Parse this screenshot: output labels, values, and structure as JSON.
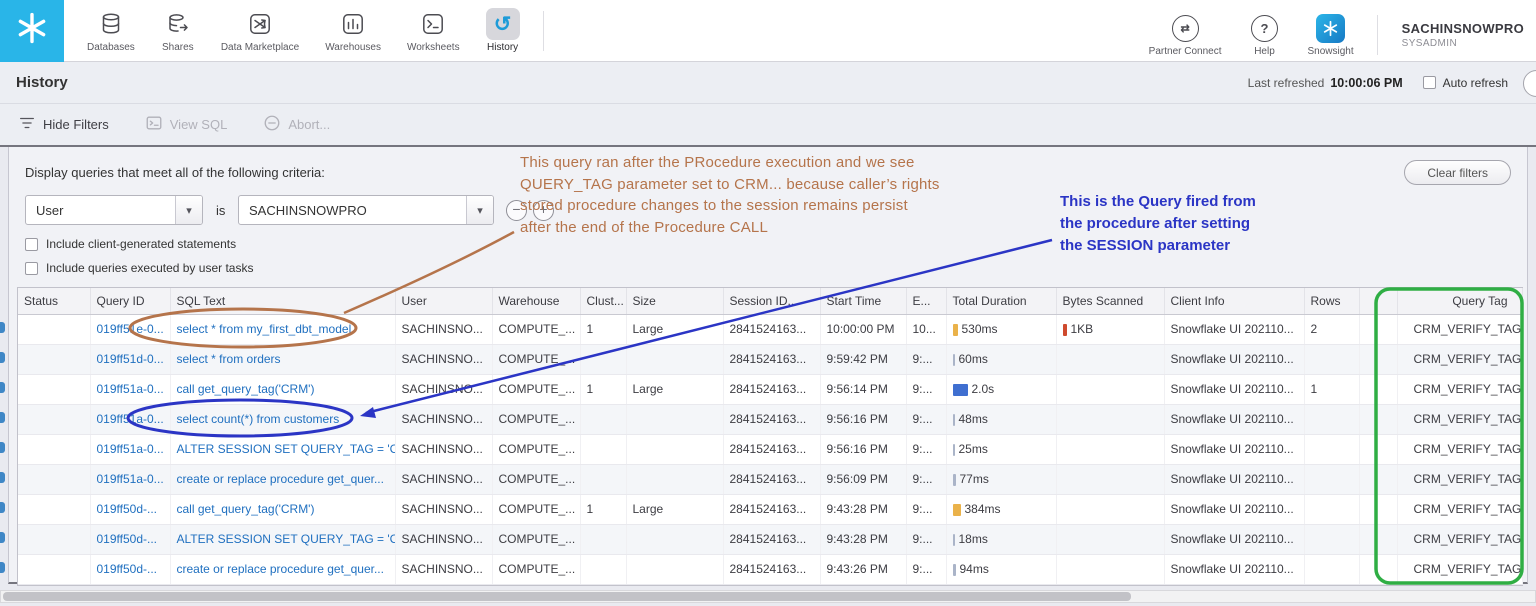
{
  "nav": {
    "account": "SACHINSNOWPRO",
    "role": "SYSADMIN",
    "items": [
      {
        "label": "Databases"
      },
      {
        "label": "Shares"
      },
      {
        "label": "Data Marketplace"
      },
      {
        "label": "Warehouses"
      },
      {
        "label": "Worksheets"
      },
      {
        "label": "History"
      }
    ],
    "right_items": [
      {
        "label": "Partner Connect"
      },
      {
        "label": "Help"
      },
      {
        "label": "Snowsight"
      }
    ]
  },
  "icons": {
    "logo": "snowflake-icon",
    "nav": [
      "databases-icon",
      "shares-icon",
      "marketplace-icon",
      "warehouses-icon",
      "worksheets-icon",
      "history-icon"
    ],
    "nav_right": [
      "partner-connect-icon",
      "help-icon",
      "snowsight-icon"
    ],
    "toolbar": [
      "filter-list-icon",
      "view-sql-icon",
      "abort-circle-icon"
    ],
    "misc": [
      "chevron-down-icon",
      "minus-icon",
      "plus-icon",
      "refresh-icon"
    ]
  },
  "header": {
    "title": "History",
    "last_refreshed_label": "Last refreshed",
    "last_refreshed_time": "10:00:06 PM",
    "auto_refresh_label": "Auto refresh"
  },
  "toolbar": {
    "hide_filters": "Hide Filters",
    "view_sql": "View SQL",
    "abort": "Abort..."
  },
  "filters": {
    "criteria_label": "Display queries that meet all of the following criteria:",
    "clear_button": "Clear filters",
    "field_selected": "User",
    "operator": "is",
    "value_selected": "SACHINSNOWPRO",
    "include_client_label": "Include client-generated statements",
    "include_tasks_label": "Include queries executed by user tasks"
  },
  "annotations": {
    "brown_note": "This query ran after the PRocedure execution and we see\nQUERY_TAG parameter set to CRM... because caller’s rights\nstored procedure changes to the session remains persist\nafter the end of the Procedure CALL",
    "blue_note": "This is the Query fired from\nthe procedure after setting\nthe SESSION parameter",
    "colors": {
      "brown": "#b5744b",
      "blue": "#2b35c5",
      "green": "#2fae44"
    }
  },
  "table": {
    "columns": [
      "Status",
      "Query ID",
      "SQL Text",
      "User",
      "Warehouse",
      "Clust...",
      "Size",
      "Session ID...",
      "Start Time",
      "E...",
      "Total Duration",
      "Bytes Scanned",
      "Client Info",
      "Rows",
      "",
      "Query Tag"
    ],
    "rows": [
      {
        "query_id": "019ff51e-0...",
        "sql": "select * from my_first_dbt_model",
        "user": "SACHINSNO...",
        "warehouse": "COMPUTE_...",
        "cluster": "1",
        "size": "Large",
        "session_id": "2841524163...",
        "start_time": "10:00:00 PM",
        "end_time": "10...",
        "duration": "530ms",
        "duration_bar": {
          "w": 5,
          "color": "#eab24a"
        },
        "bytes_scanned": "1KB",
        "bytes_bar": {
          "w": 4,
          "color": "#cf4a2e"
        },
        "client_info": "Snowflake UI 202110...",
        "rows": "2",
        "query_tag": "CRM_VERIFY_TAG"
      },
      {
        "query_id": "019ff51d-0...",
        "sql": "select * from orders",
        "user": "SACHINSNO...",
        "warehouse": "COMPUTE_...",
        "cluster": "",
        "size": "",
        "session_id": "2841524163...",
        "start_time": "9:59:42 PM",
        "end_time": "9:...",
        "duration": "60ms",
        "duration_bar": {
          "w": 2,
          "color": "#aab4c8"
        },
        "bytes_scanned": "",
        "bytes_bar": {
          "w": 0,
          "color": ""
        },
        "client_info": "Snowflake UI 202110...",
        "rows": "",
        "query_tag": "CRM_VERIFY_TAG"
      },
      {
        "query_id": "019ff51a-0...",
        "sql": "call get_query_tag('CRM')",
        "user": "SACHINSNO...",
        "warehouse": "COMPUTE_...",
        "cluster": "1",
        "size": "Large",
        "session_id": "2841524163...",
        "start_time": "9:56:14 PM",
        "end_time": "9:...",
        "duration": "2.0s",
        "duration_bar": {
          "w": 15,
          "color": "#3f6fd0"
        },
        "bytes_scanned": "",
        "bytes_bar": {
          "w": 0,
          "color": ""
        },
        "client_info": "Snowflake UI 202110...",
        "rows": "1",
        "query_tag": "CRM_VERIFY_TAG"
      },
      {
        "query_id": "019ff51a-0...",
        "sql": "select count(*) from customers",
        "user": "SACHINSNO...",
        "warehouse": "COMPUTE_...",
        "cluster": "",
        "size": "",
        "session_id": "2841524163...",
        "start_time": "9:56:16 PM",
        "end_time": "9:...",
        "duration": "48ms",
        "duration_bar": {
          "w": 2,
          "color": "#aab4c8"
        },
        "bytes_scanned": "",
        "bytes_bar": {
          "w": 0,
          "color": ""
        },
        "client_info": "Snowflake UI 202110...",
        "rows": "",
        "query_tag": "CRM_VERIFY_TAG"
      },
      {
        "query_id": "019ff51a-0...",
        "sql": "ALTER SESSION SET QUERY_TAG = 'C...",
        "user": "SACHINSNO...",
        "warehouse": "COMPUTE_...",
        "cluster": "",
        "size": "",
        "session_id": "2841524163...",
        "start_time": "9:56:16 PM",
        "end_time": "9:...",
        "duration": "25ms",
        "duration_bar": {
          "w": 2,
          "color": "#aab4c8"
        },
        "bytes_scanned": "",
        "bytes_bar": {
          "w": 0,
          "color": ""
        },
        "client_info": "Snowflake UI 202110...",
        "rows": "",
        "query_tag": "CRM_VERIFY_TAG"
      },
      {
        "query_id": "019ff51a-0...",
        "sql": "create or replace procedure get_quer...",
        "user": "SACHINSNO...",
        "warehouse": "COMPUTE_...",
        "cluster": "",
        "size": "",
        "session_id": "2841524163...",
        "start_time": "9:56:09 PM",
        "end_time": "9:...",
        "duration": "77ms",
        "duration_bar": {
          "w": 3,
          "color": "#aab4c8"
        },
        "bytes_scanned": "",
        "bytes_bar": {
          "w": 0,
          "color": ""
        },
        "client_info": "Snowflake UI 202110...",
        "rows": "",
        "query_tag": "CRM_VERIFY_TAG"
      },
      {
        "query_id": "019ff50d-...",
        "sql": "call get_query_tag('CRM')",
        "user": "SACHINSNO...",
        "warehouse": "COMPUTE_...",
        "cluster": "1",
        "size": "Large",
        "session_id": "2841524163...",
        "start_time": "9:43:28 PM",
        "end_time": "9:...",
        "duration": "384ms",
        "duration_bar": {
          "w": 8,
          "color": "#eab24a"
        },
        "bytes_scanned": "",
        "bytes_bar": {
          "w": 0,
          "color": ""
        },
        "client_info": "Snowflake UI 202110...",
        "rows": "",
        "query_tag": "CRM_VERIFY_TAG"
      },
      {
        "query_id": "019ff50d-...",
        "sql": "ALTER SESSION SET QUERY_TAG = 'C...",
        "user": "SACHINSNO...",
        "warehouse": "COMPUTE_...",
        "cluster": "",
        "size": "",
        "session_id": "2841524163...",
        "start_time": "9:43:28 PM",
        "end_time": "9:...",
        "duration": "18ms",
        "duration_bar": {
          "w": 2,
          "color": "#aab4c8"
        },
        "bytes_scanned": "",
        "bytes_bar": {
          "w": 0,
          "color": ""
        },
        "client_info": "Snowflake UI 202110...",
        "rows": "",
        "query_tag": "CRM_VERIFY_TAG"
      },
      {
        "query_id": "019ff50d-...",
        "sql": "create or replace procedure get_quer...",
        "user": "SACHINSNO...",
        "warehouse": "COMPUTE_...",
        "cluster": "",
        "size": "",
        "session_id": "2841524163...",
        "start_time": "9:43:26 PM",
        "end_time": "9:...",
        "duration": "94ms",
        "duration_bar": {
          "w": 3,
          "color": "#aab4c8"
        },
        "bytes_scanned": "",
        "bytes_bar": {
          "w": 0,
          "color": ""
        },
        "client_info": "Snowflake UI 202110...",
        "rows": "",
        "query_tag": "CRM_VERIFY_TAG"
      }
    ]
  }
}
